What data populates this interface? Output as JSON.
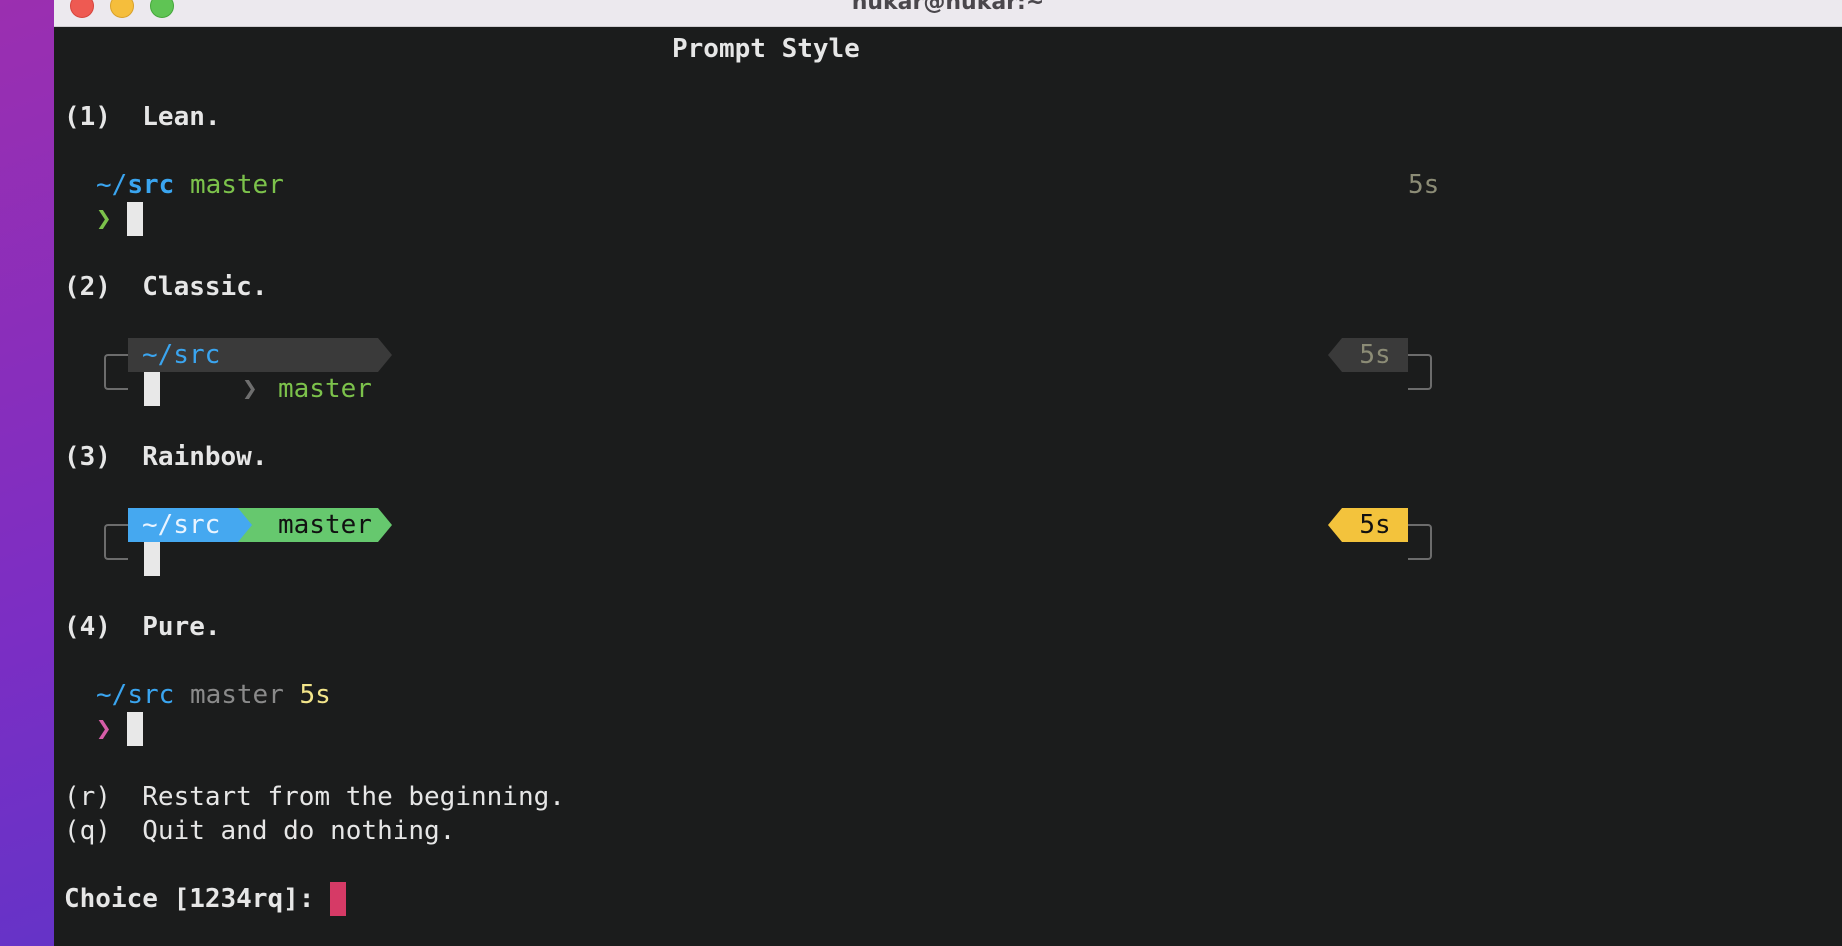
{
  "window": {
    "title": "nukar@nukar:~"
  },
  "heading": "Prompt Style",
  "options": {
    "lean": {
      "label": "(1)  Lean.",
      "dir_prefix": "~/",
      "dir": "src",
      "branch": "master",
      "time": "5s",
      "prompt_char": "❯"
    },
    "classic": {
      "label": "(2)  Classic.",
      "dir": "~/src",
      "branch": "master",
      "time": "5s"
    },
    "rainbow": {
      "label": "(3)  Rainbow.",
      "dir": "~/src",
      "branch": "master",
      "time": "5s"
    },
    "pure": {
      "label": "(4)  Pure.",
      "dir_prefix": "~/",
      "dir": "src",
      "branch": "master",
      "time": "5s",
      "prompt_char": "❯"
    }
  },
  "restart": "(r)  Restart from the beginning.",
  "quit": "(q)  Quit and do nothing.",
  "choice_prompt": "Choice [1234rq]: ",
  "colors": {
    "classic_bg": "#3a3a3a",
    "rainbow_dir_bg": "#45a8f0",
    "rainbow_branch_bg": "#66c86e",
    "rainbow_time_bg": "#f3c33c",
    "cursor_accent": "#d63a66"
  }
}
